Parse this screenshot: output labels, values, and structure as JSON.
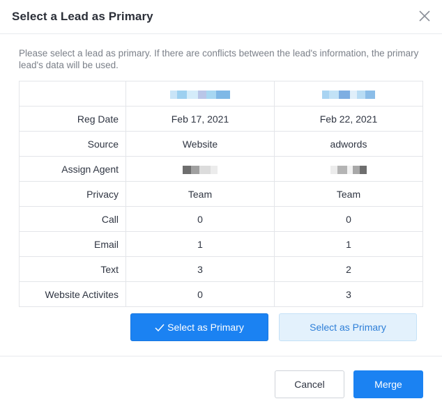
{
  "dialog": {
    "title": "Select a Lead as Primary",
    "description": "Please select a lead as primary. If there are conflicts between the lead's information, the primary lead's data will be used."
  },
  "table": {
    "rows": [
      {
        "label": "Reg Date",
        "a": "Feb 17, 2021",
        "b": "Feb 22, 2021"
      },
      {
        "label": "Source",
        "a": "Website",
        "b": "adwords"
      },
      {
        "label": "Assign Agent",
        "a": "",
        "b": ""
      },
      {
        "label": "Privacy",
        "a": "Team",
        "b": "Team"
      },
      {
        "label": "Call",
        "a": "0",
        "b": "0"
      },
      {
        "label": "Email",
        "a": "1",
        "b": "1"
      },
      {
        "label": "Text",
        "a": "3",
        "b": "2"
      },
      {
        "label": "Website Activites",
        "a": "0",
        "b": "3"
      }
    ]
  },
  "buttons": {
    "select_a": "Select as Primary",
    "select_b": "Select as Primary",
    "cancel": "Cancel",
    "merge": "Merge"
  },
  "icons": {
    "close": "close-icon",
    "check": "check-icon"
  },
  "colors": {
    "primary": "#1b82f2",
    "secondary_bg": "#e3f1fc",
    "secondary_text": "#2e7fd8"
  }
}
